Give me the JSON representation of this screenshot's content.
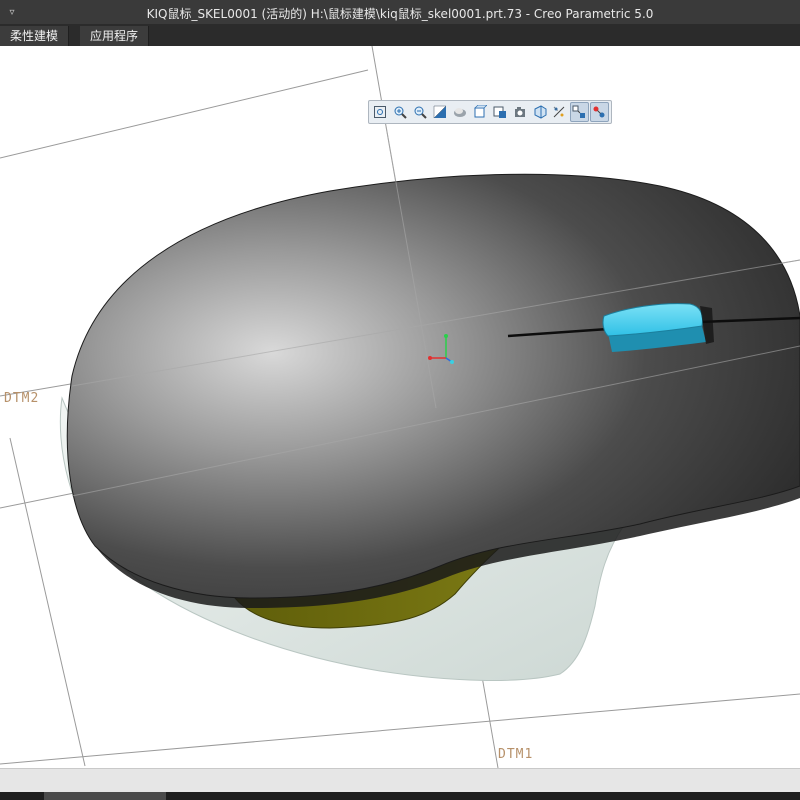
{
  "window": {
    "title": "KIQ鼠标_SKEL0001 (活动的) H:\\鼠标建模\\kiq鼠标_skel0001.prt.73 - Creo Parametric 5.0",
    "menu_glyph": "▿"
  },
  "menubar": {
    "tabs": [
      {
        "label": "柔性建模"
      },
      {
        "label": "应用程序"
      }
    ]
  },
  "view_toolbar": {
    "buttons": [
      {
        "name": "refit-icon"
      },
      {
        "name": "zoom-in-icon"
      },
      {
        "name": "zoom-out-icon"
      },
      {
        "name": "repaint-icon"
      },
      {
        "name": "display-style-icon"
      },
      {
        "name": "saved-orientations-icon"
      },
      {
        "name": "view-manager-icon"
      },
      {
        "name": "perspective-icon"
      },
      {
        "name": "section-icon"
      },
      {
        "name": "datum-display-icon"
      },
      {
        "name": "spin-center-icon",
        "active": true
      },
      {
        "name": "annotation-display-icon",
        "active": true
      }
    ]
  },
  "viewport": {
    "datum_labels": [
      "DTM2",
      "DTM1"
    ],
    "colors": {
      "mouse_shell_dark": "#2e2e2e",
      "mouse_shell_light": "#cfcfcf",
      "scroll_wheel": "#3cc8ea",
      "side_insert": "#6b6a10",
      "base": "#dde6e3",
      "datum_plane": "#b7916a"
    }
  }
}
